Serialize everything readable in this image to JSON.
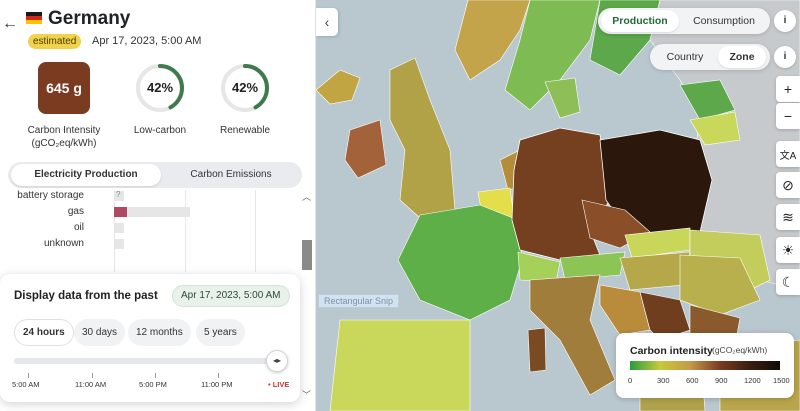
{
  "zone": {
    "name": "Germany",
    "badge": "estimated",
    "datetime": "Apr 17, 2023, 5:00 AM",
    "back_icon": "arrow-left-icon",
    "collapse_icon": "chevron-left-icon",
    "flag_colors": [
      "#1a1a1a",
      "#d8251d",
      "#f5c600"
    ]
  },
  "metrics": {
    "carbon_intensity": {
      "value": "645 g",
      "label_line1": "Carbon Intensity",
      "label_line2": "(gCO₂eq/kWh)",
      "color": "#7a3b21"
    },
    "low_carbon": {
      "value": "42%",
      "label": "Low-carbon",
      "fraction": 0.42
    },
    "renewable": {
      "value": "42%",
      "label": "Renewable",
      "fraction": 0.42
    }
  },
  "panel_tabs": {
    "production": "Electricity Production",
    "emissions": "Carbon Emissions",
    "active": "production"
  },
  "production_rows": [
    {
      "label": "battery storage",
      "share": 0.0,
      "color": "#bdbdbd",
      "note": "?"
    },
    {
      "label": "gas",
      "share": 0.18,
      "color": "#b04a63"
    },
    {
      "label": "oil",
      "share": 0.0,
      "color": "#999999"
    },
    {
      "label": "unknown",
      "share": 0.0,
      "color": "#999999"
    }
  ],
  "time_card": {
    "title": "Display data from the past",
    "date_chip": "Apr 17, 2023, 5:00 AM",
    "ranges": [
      "24 hours",
      "30 days",
      "12 months",
      "5 years"
    ],
    "active_range": "24 hours",
    "slider_position": 1.0,
    "slider_icon": "drag-handle-icon",
    "tick_labels": [
      "5:00 AM",
      "11:00 AM",
      "5:00 PM",
      "11:00 PM"
    ],
    "live_label": "LIVE"
  },
  "map_toggles": {
    "mode": {
      "production": "Production",
      "consumption": "Consumption",
      "active": "Production"
    },
    "granularity": {
      "country": "Country",
      "zone": "Zone",
      "active": "Zone"
    },
    "info_label": "i"
  },
  "map_controls": [
    {
      "name": "zoom-in-button",
      "glyph": "+"
    },
    {
      "name": "zoom-out-button",
      "glyph": "−"
    },
    {
      "name": "language-button",
      "glyph": "文A",
      "icon": "language-icon"
    },
    {
      "name": "hide-map-button",
      "glyph": "⊘",
      "icon": "eye-off-icon"
    },
    {
      "name": "wind-layer-button",
      "glyph": "≋",
      "icon": "wind-icon"
    },
    {
      "name": "solar-layer-button",
      "glyph": "☀",
      "icon": "sun-icon"
    },
    {
      "name": "theme-button",
      "glyph": "☾",
      "icon": "moon-icon"
    }
  ],
  "map_tooltip": "Rectangular Snip",
  "legend": {
    "title": "Carbon intensity",
    "unit": "(gCO₂eq/kWh)",
    "ticks": [
      "0",
      "300",
      "600",
      "900",
      "1200",
      "1500"
    ],
    "gradient": [
      "#2a9d3f",
      "#c7c93a",
      "#c49a4a",
      "#7a3b21",
      "#3b1e10",
      "#0f0a06"
    ]
  },
  "map_colors": {
    "sea": "#b9c7cf",
    "germany": "#74401f",
    "poland": "#2b170b",
    "france": "#5eaf48",
    "uk": "#b1a147",
    "ireland": "#a3623a",
    "iceland": "#c1a543",
    "norway": "#c3a44b",
    "sweden": "#7fbb53",
    "finland": "#5ca84a"
  }
}
